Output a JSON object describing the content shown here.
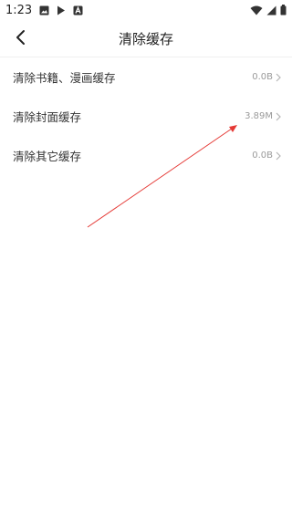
{
  "status_bar": {
    "time": "1:23",
    "left_icons": [
      "image-icon",
      "play-store-icon",
      "a-badge-icon"
    ],
    "right_icons": [
      "wifi-icon",
      "signal-icon",
      "battery-icon"
    ]
  },
  "header": {
    "title": "清除缓存",
    "back_icon": "chevron-left-icon"
  },
  "cache_items": [
    {
      "label": "清除书籍、漫画缓存",
      "size": "0.0B"
    },
    {
      "label": "清除封面缓存",
      "size": "3.89M"
    },
    {
      "label": "清除其它缓存",
      "size": "0.0B"
    }
  ],
  "annotation": {
    "color": "#e53935",
    "icon": "red-arrow-annotation"
  }
}
